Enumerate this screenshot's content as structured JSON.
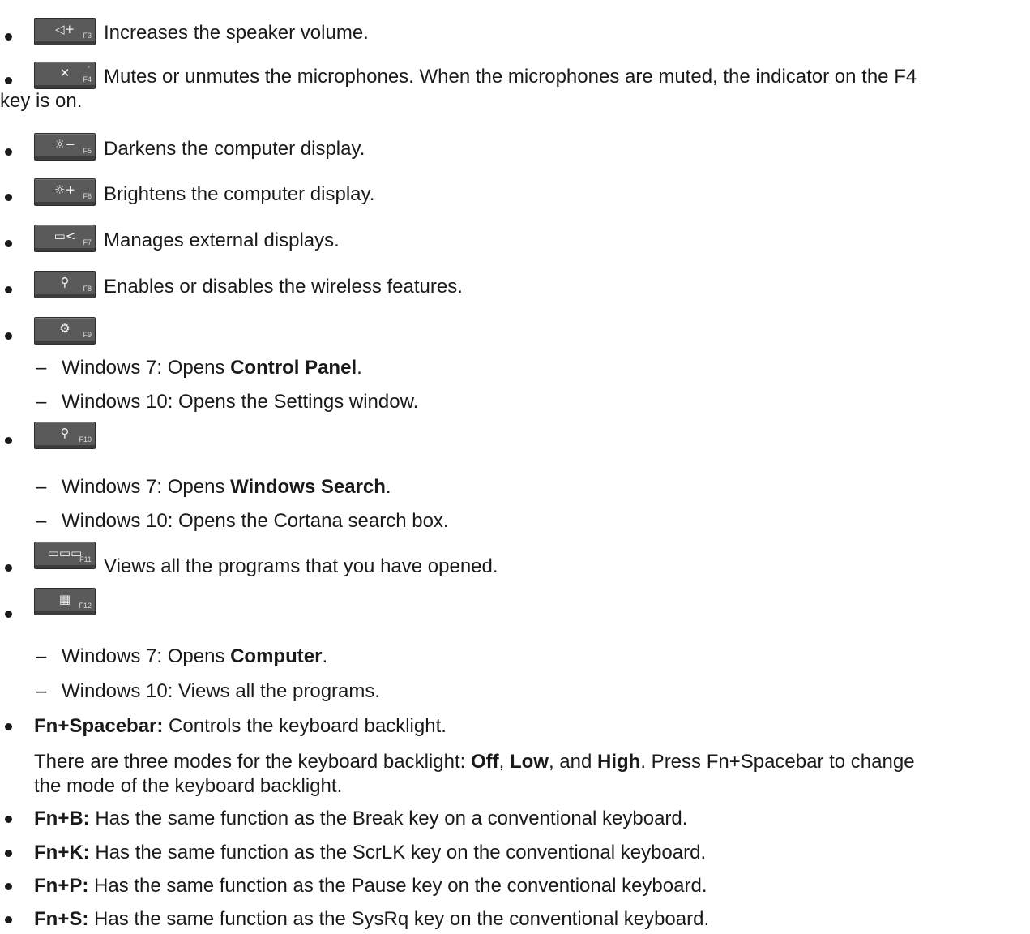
{
  "items": [
    {
      "key_glyph": "◁+",
      "key_fn": "F3",
      "text": "Increases the speaker volume."
    },
    {
      "key_glyph": "✕",
      "key_fn": "F4",
      "text_line1": "Mutes or unmutes the microphones. When the microphones are muted, the indicator on the F4",
      "text_line2": "key is on."
    },
    {
      "key_glyph": "☼−",
      "key_fn": "F5",
      "text": "Darkens the computer display."
    },
    {
      "key_glyph": "☼+",
      "key_fn": "F6",
      "text": "Brightens the computer display."
    },
    {
      "key_glyph": "▭<",
      "key_fn": "F7",
      "text": "Manages external displays."
    },
    {
      "key_glyph": "⚲",
      "key_fn": "F8",
      "text": "Enables or disables the wireless features."
    },
    {
      "key_glyph": "⚙",
      "key_fn": "F9",
      "sub1_prefix": "Windows 7: Opens ",
      "sub1_bold": "Control Panel",
      "sub1_suffix": ".",
      "sub2": "Windows 10: Opens the Settings window."
    },
    {
      "key_glyph": "⚲",
      "key_fn": "F10",
      "sub1_prefix": "Windows 7: Opens ",
      "sub1_bold": "Windows Search",
      "sub1_suffix": ".",
      "sub2": "Windows 10: Opens the Cortana search box."
    },
    {
      "key_glyph": "▭▭▭",
      "key_fn": "F11",
      "text": "Views all the programs that you have opened."
    },
    {
      "key_glyph": "▦",
      "key_fn": "F12",
      "sub1_prefix": "Windows 7: Opens ",
      "sub1_bold": "Computer",
      "sub1_suffix": ".",
      "sub2": "Windows 10: Views all the programs."
    }
  ],
  "dash": "–",
  "fn_space": {
    "label": "Fn+Spacebar:",
    "text": " Controls the keyboard backlight.",
    "para_a": "There are three modes for the keyboard backlight: ",
    "off": "Off",
    "comma1": ", ",
    "low": "Low",
    "and": ", and ",
    "high": "High",
    "para_b": ". Press Fn+Spacebar to change",
    "para_line2": "the mode of the keyboard backlight."
  },
  "fn_b": {
    "label": "Fn+B:",
    "text": " Has the same function as the Break key on a conventional keyboard."
  },
  "fn_k": {
    "label": "Fn+K:",
    "text": " Has the same function as the ScrLK key on the conventional keyboard."
  },
  "fn_p": {
    "label": "Fn+P:",
    "text": " Has the same function as the Pause key on the conventional keyboard."
  },
  "fn_s": {
    "label": "Fn+S:",
    "text": " Has the same function as the SysRq key on the conventional keyboard."
  }
}
